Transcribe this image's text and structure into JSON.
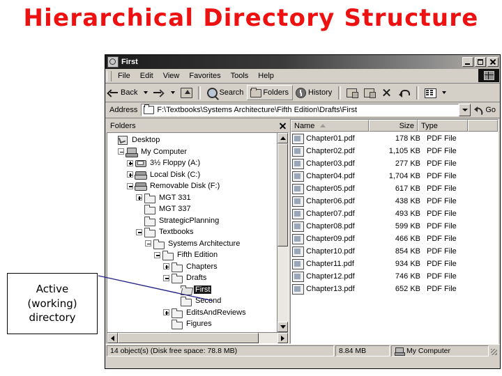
{
  "slide": {
    "title": "Hierarchical Directory Structure",
    "title_color": "#ee1111"
  },
  "callout": {
    "line1": "Active",
    "line2": "(working)",
    "line3": "directory",
    "line_color": "#242484"
  },
  "window": {
    "title": "First",
    "icon": "folder-search-icon",
    "buttons": {
      "minimize": "_",
      "maximize": "□",
      "close": "×"
    },
    "menu": [
      "File",
      "Edit",
      "View",
      "Favorites",
      "Tools",
      "Help"
    ],
    "brand_icon": "windows-flag-icon",
    "toolbar": [
      {
        "name": "back",
        "label": "Back",
        "icon": "arrow-left-icon",
        "has_dropdown": true,
        "pressed": false
      },
      {
        "name": "forward",
        "label": "",
        "icon": "arrow-right-icon",
        "has_dropdown": true,
        "pressed": false
      },
      {
        "name": "up",
        "label": "",
        "icon": "folder-up-icon",
        "has_dropdown": false,
        "pressed": false
      },
      {
        "name": "search",
        "label": "Search",
        "icon": "search-icon",
        "has_dropdown": false,
        "pressed": false
      },
      {
        "name": "folders",
        "label": "Folders",
        "icon": "folder-icon",
        "has_dropdown": false,
        "pressed": true
      },
      {
        "name": "history",
        "label": "History",
        "icon": "history-icon",
        "has_dropdown": false,
        "pressed": false
      },
      {
        "name": "move-to",
        "label": "",
        "icon": "move-to-folder-icon",
        "has_dropdown": false,
        "pressed": false
      },
      {
        "name": "copy-to",
        "label": "",
        "icon": "copy-to-folder-icon",
        "has_dropdown": false,
        "pressed": false
      },
      {
        "name": "delete",
        "label": "",
        "icon": "delete-x-icon",
        "has_dropdown": false,
        "pressed": false
      },
      {
        "name": "undo",
        "label": "",
        "icon": "undo-icon",
        "has_dropdown": false,
        "pressed": false
      },
      {
        "name": "views",
        "label": "",
        "icon": "views-icon",
        "has_dropdown": true,
        "pressed": false
      }
    ],
    "address": {
      "label": "Address",
      "value": "F:\\Textbooks\\Systems Architecture\\Fifth Edition\\Drafts\\First",
      "go_label": "Go"
    },
    "folders_pane": {
      "header": "Folders",
      "tree": [
        {
          "label": "Desktop",
          "depth": 0,
          "toggle": "none",
          "icon": "desktop-icon",
          "selected": false
        },
        {
          "label": "My Computer",
          "depth": 1,
          "toggle": "minus",
          "icon": "my-computer-icon",
          "selected": false
        },
        {
          "label": "3½ Floppy (A:)",
          "depth": 2,
          "toggle": "plus",
          "icon": "floppy-drive-icon",
          "selected": false
        },
        {
          "label": "Local Disk (C:)",
          "depth": 2,
          "toggle": "plus",
          "icon": "hard-disk-icon",
          "selected": false
        },
        {
          "label": "Removable Disk (F:)",
          "depth": 2,
          "toggle": "minus",
          "icon": "removable-disk-icon",
          "selected": false
        },
        {
          "label": "MGT 331",
          "depth": 3,
          "toggle": "plus",
          "icon": "folder-icon",
          "selected": false
        },
        {
          "label": "MGT 337",
          "depth": 3,
          "toggle": "none",
          "icon": "folder-icon",
          "selected": false
        },
        {
          "label": "StrategicPlanning",
          "depth": 3,
          "toggle": "none",
          "icon": "folder-icon",
          "selected": false
        },
        {
          "label": "Textbooks",
          "depth": 3,
          "toggle": "minus",
          "icon": "folder-icon",
          "selected": false
        },
        {
          "label": "Systems Architecture",
          "depth": 4,
          "toggle": "minus",
          "icon": "folder-icon",
          "selected": false
        },
        {
          "label": "Fifth Edition",
          "depth": 5,
          "toggle": "minus",
          "icon": "folder-icon",
          "selected": false
        },
        {
          "label": "Chapters",
          "depth": 6,
          "toggle": "plus",
          "icon": "folder-icon",
          "selected": false
        },
        {
          "label": "Drafts",
          "depth": 6,
          "toggle": "minus",
          "icon": "folder-icon",
          "selected": false
        },
        {
          "label": "First",
          "depth": 7,
          "toggle": "none",
          "icon": "folder-open-icon",
          "selected": true
        },
        {
          "label": "Second",
          "depth": 7,
          "toggle": "none",
          "icon": "folder-icon",
          "selected": false
        },
        {
          "label": "EditsAndReviews",
          "depth": 6,
          "toggle": "plus",
          "icon": "folder-icon",
          "selected": false
        },
        {
          "label": "Figures",
          "depth": 6,
          "toggle": "none",
          "icon": "folder-icon",
          "selected": false
        }
      ]
    },
    "file_pane": {
      "columns": [
        "Name",
        "Size",
        "Type"
      ],
      "sort_column": "Name",
      "sort_direction": "ascending",
      "rows": [
        {
          "name": "Chapter01.pdf",
          "size": "178 KB",
          "type": "PDF File"
        },
        {
          "name": "Chapter02.pdf",
          "size": "1,105 KB",
          "type": "PDF File"
        },
        {
          "name": "Chapter03.pdf",
          "size": "277 KB",
          "type": "PDF File"
        },
        {
          "name": "Chapter04.pdf",
          "size": "1,704 KB",
          "type": "PDF File"
        },
        {
          "name": "Chapter05.pdf",
          "size": "617 KB",
          "type": "PDF File"
        },
        {
          "name": "Chapter06.pdf",
          "size": "438 KB",
          "type": "PDF File"
        },
        {
          "name": "Chapter07.pdf",
          "size": "493 KB",
          "type": "PDF File"
        },
        {
          "name": "Chapter08.pdf",
          "size": "599 KB",
          "type": "PDF File"
        },
        {
          "name": "Chapter09.pdf",
          "size": "466 KB",
          "type": "PDF File"
        },
        {
          "name": "Chapter10.pdf",
          "size": "854 KB",
          "type": "PDF File"
        },
        {
          "name": "Chapter11.pdf",
          "size": "934 KB",
          "type": "PDF File"
        },
        {
          "name": "Chapter12.pdf",
          "size": "746 KB",
          "type": "PDF File"
        },
        {
          "name": "Chapter13.pdf",
          "size": "652 KB",
          "type": "PDF File"
        }
      ]
    },
    "status_bar": {
      "objects": "14 object(s) (Disk free space: 78.8 MB)",
      "total_size": "8.84 MB",
      "location": "My Computer"
    }
  }
}
